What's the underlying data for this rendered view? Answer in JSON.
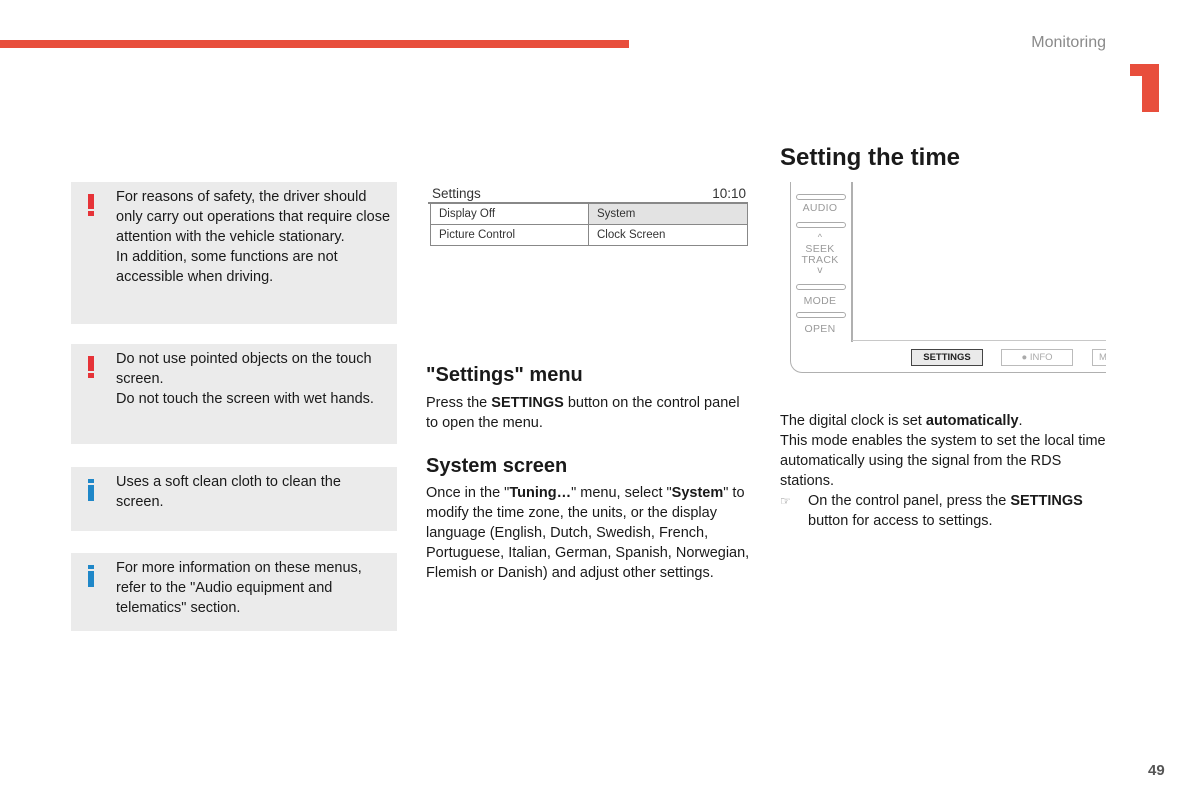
{
  "header": {
    "section_label": "Monitoring",
    "chapter_number": "1",
    "accent_color": "#e84e3c"
  },
  "notices": [
    {
      "type": "warning",
      "icon": "exclamation-icon",
      "text": "For reasons of safety, the driver should only carry out operations that require close attention with the vehicle stationary.\nIn addition, some functions are not accessible when driving."
    },
    {
      "type": "warning",
      "icon": "exclamation-icon",
      "text": "Do not use pointed objects on the touch screen.\nDo not touch the screen with wet hands."
    },
    {
      "type": "info",
      "icon": "info-icon",
      "text": "Uses a soft clean cloth to clean the screen."
    },
    {
      "type": "info",
      "icon": "info-icon",
      "text": "For more information on these menus, refer to the \"Audio equipment and telematics\" section."
    }
  ],
  "settings_screen": {
    "title": "Settings",
    "clock": "10:10",
    "items": [
      {
        "label": "Display Off",
        "selected": false
      },
      {
        "label": "System",
        "selected": true
      },
      {
        "label": "Picture Control",
        "selected": false
      },
      {
        "label": "Clock Screen",
        "selected": false
      }
    ]
  },
  "settings_menu": {
    "heading": "\"Settings\" menu",
    "text_before": "Press the ",
    "bold": "SETTINGS",
    "text_after": " button on the control panel to open the menu."
  },
  "system_screen": {
    "heading": "System screen",
    "t1": "Once in the \"",
    "b1": "Tuning…",
    "t2": "\" menu, select \"",
    "b2": "System",
    "t3": "\" to modify the time zone, the units, or the display language (English, Dutch, Swedish, French, Portuguese, Italian, German, Spanish, Norwegian, Flemish or Danish) and adjust other settings."
  },
  "setting_time": {
    "heading": "Setting the time",
    "t1": "The digital clock is set ",
    "b1": "automatically",
    "t2": ".",
    "line2": "This mode enables the system to set the local time automatically using the signal from the RDS stations.",
    "bullet_icon": "hand-pointer-icon",
    "bullet_t1": "On the control panel, press the ",
    "bullet_b1": "SETTINGS",
    "bullet_t2": " button for access to settings."
  },
  "control_panel": {
    "side_buttons": [
      "AUDIO",
      "SEEK",
      "TRACK",
      "MODE",
      "OPEN"
    ],
    "bottom_buttons": [
      "SETTINGS",
      "● INFO",
      "M"
    ]
  },
  "footer": {
    "page_number": "49"
  }
}
